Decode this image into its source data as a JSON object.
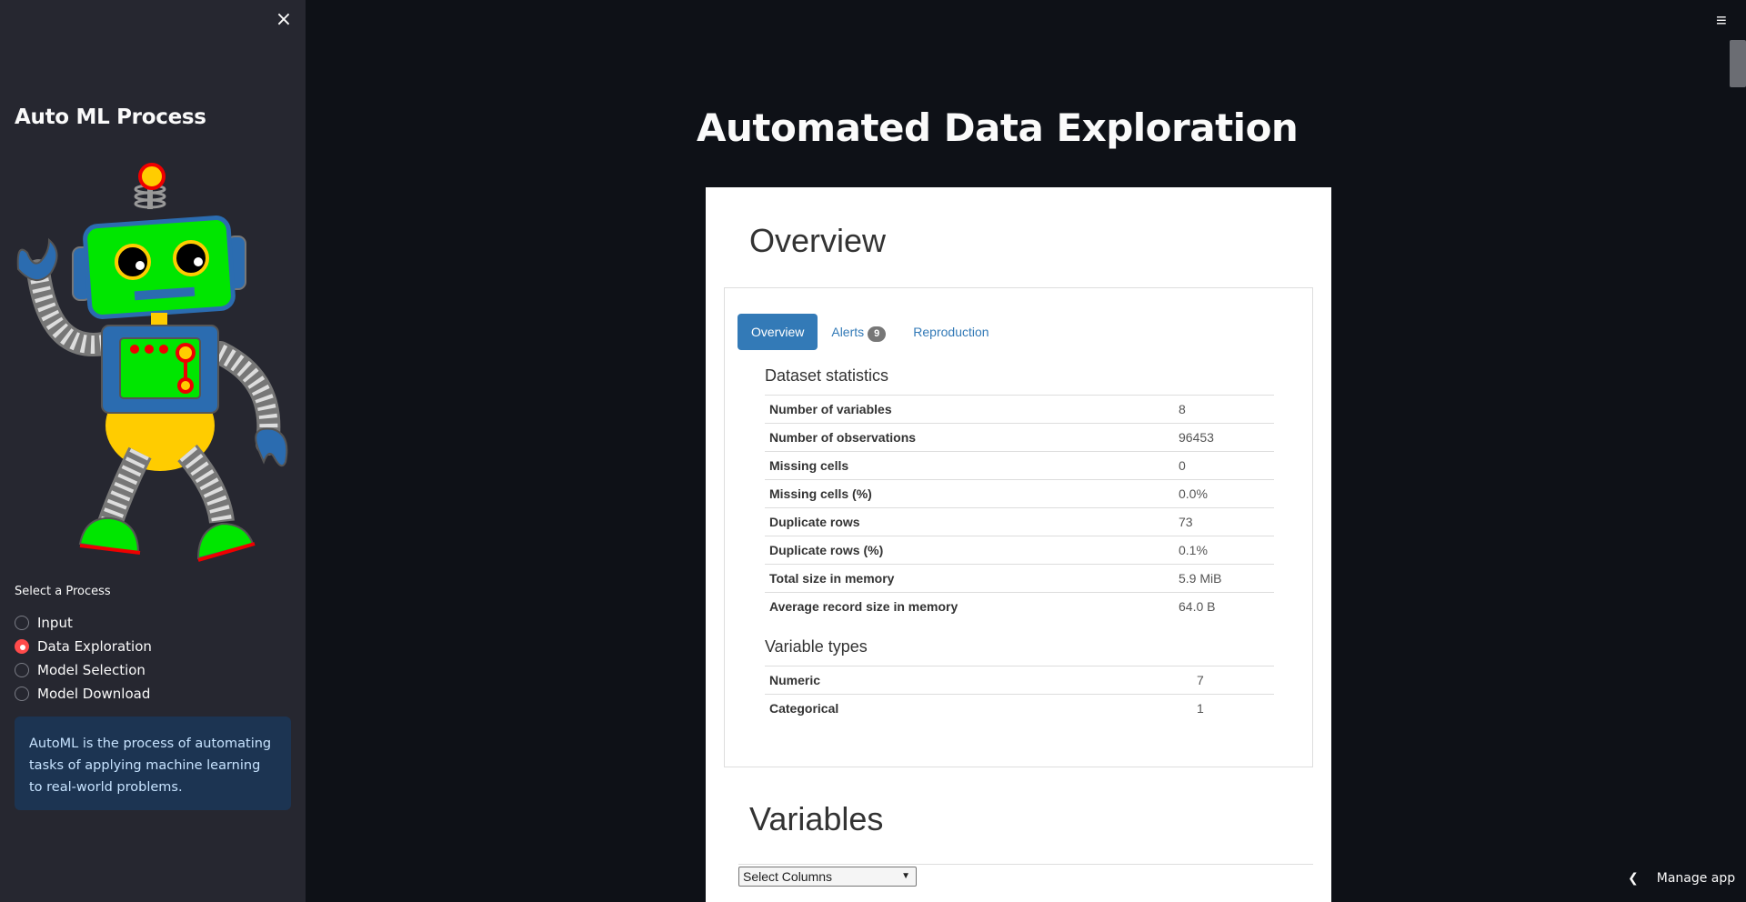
{
  "sidebar": {
    "close_icon": "×",
    "title": "Auto ML Process",
    "radio_label": "Select a Process",
    "options": [
      {
        "label": "Input",
        "selected": false
      },
      {
        "label": "Data Exploration",
        "selected": true
      },
      {
        "label": "Model Selection",
        "selected": false
      },
      {
        "label": "Model Download",
        "selected": false
      }
    ],
    "info": "AutoML is the process of automating tasks of applying machine learning to real-world problems."
  },
  "main": {
    "menu_icon": "≡",
    "title": "Automated Data Exploration"
  },
  "report": {
    "overview_heading": "Overview",
    "tabs": [
      {
        "label": "Overview"
      },
      {
        "label": "Alerts",
        "badge": "9"
      },
      {
        "label": "Reproduction"
      }
    ],
    "dataset_stats_heading": "Dataset statistics",
    "dataset_stats": [
      {
        "k": "Number of variables",
        "v": "8"
      },
      {
        "k": "Number of observations",
        "v": "96453"
      },
      {
        "k": "Missing cells",
        "v": "0"
      },
      {
        "k": "Missing cells (%)",
        "v": "0.0%"
      },
      {
        "k": "Duplicate rows",
        "v": "73"
      },
      {
        "k": "Duplicate rows (%)",
        "v": "0.1%"
      },
      {
        "k": "Total size in memory",
        "v": "5.9 MiB"
      },
      {
        "k": "Average record size in memory",
        "v": "64.0 B"
      }
    ],
    "variable_types_heading": "Variable types",
    "variable_types": [
      {
        "k": "Numeric",
        "v": "7"
      },
      {
        "k": "Categorical",
        "v": "1"
      }
    ],
    "variables_heading": "Variables",
    "select_columns": "Select Columns"
  },
  "footer": {
    "manage_app": "Manage app"
  },
  "colors": {
    "background": "#0e1117",
    "sidebar": "#262730",
    "accent": "#ff4b4b",
    "info_bg": "#1c3452",
    "link": "#337ab7"
  }
}
